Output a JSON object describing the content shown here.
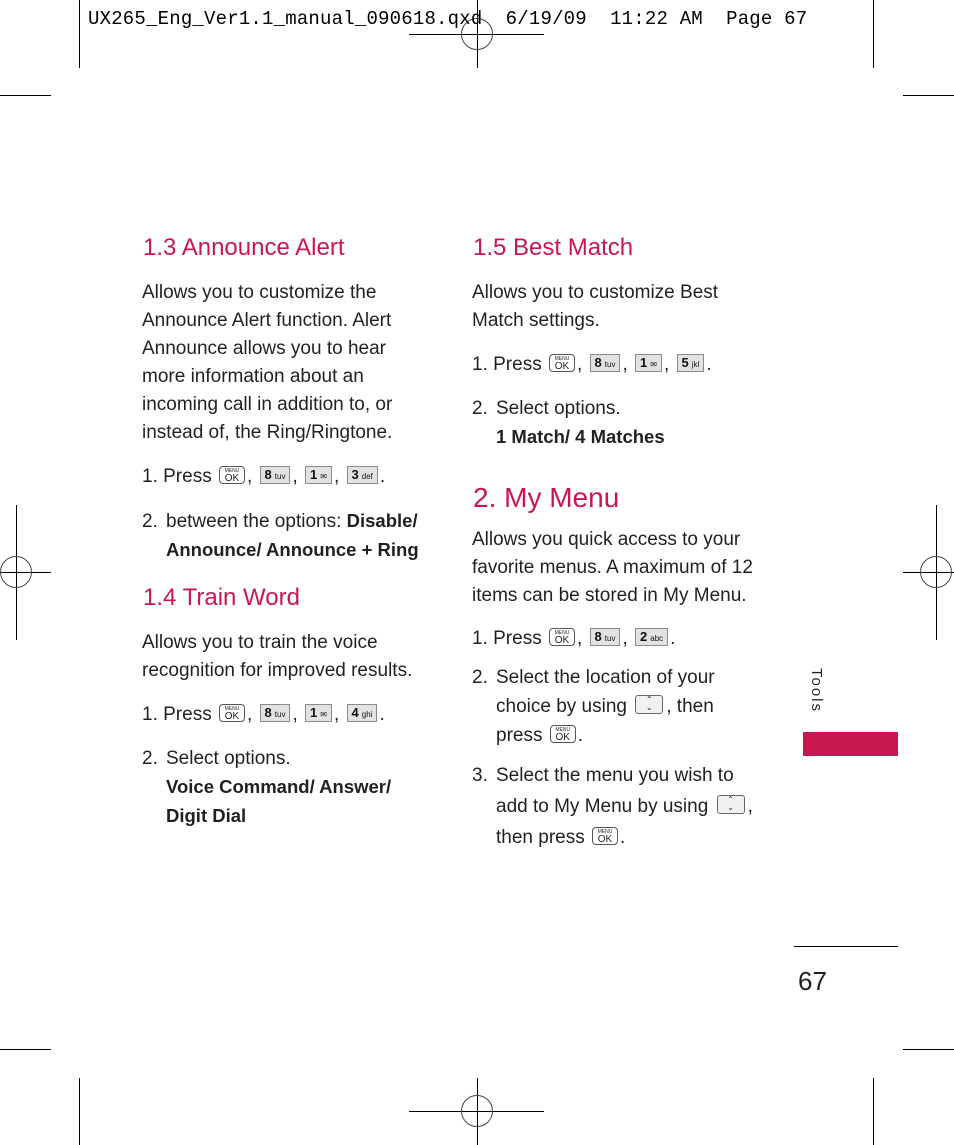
{
  "slug": "UX265_Eng_Ver1.1_manual_090618.qxd  6/19/09  11:22 AM  Page 67",
  "keys": {
    "menu_ok": {
      "top": "MENU",
      "main": "OK"
    },
    "k8": {
      "digit": "8",
      "letters": "tuv"
    },
    "k1": {
      "digit": "1",
      "letters": "✉"
    },
    "k3": {
      "digit": "3",
      "letters": "def"
    },
    "k4": {
      "digit": "4",
      "letters": "ghi"
    },
    "k5": {
      "digit": "5",
      "letters": "jkl"
    },
    "k2": {
      "digit": "2",
      "letters": "abc"
    },
    "nav": {
      "up": "⌃",
      "down": "⌄"
    }
  },
  "sections": {
    "announce_alert": {
      "title": "1.3 Announce Alert",
      "body": "Allows you to customize the Announce Alert function. Alert Announce allows you to hear more information about an incoming call in addition to, or instead of, the Ring/Ringtone.",
      "step1_prefix": "1. Press",
      "step2_num": "2.",
      "step2_text": "between the options: ",
      "step2_options_a": "Disable/",
      "step2_options_b": "Announce/ Announce + Ring"
    },
    "train_word": {
      "title": "1.4 Train Word",
      "body": "Allows you to train the voice recognition for improved results.",
      "step1_prefix": "1. Press",
      "step2_num": "2.",
      "step2_text": "Select options.",
      "step2_options_a": "Voice Command/ Answer/",
      "step2_options_b": "Digit Dial"
    },
    "best_match": {
      "title": "1.5 Best Match",
      "body": "Allows you to customize Best Match settings.",
      "step1_prefix": "1. Press",
      "step2_num": "2.",
      "step2_text": "Select options.",
      "step2_options": "1 Match/ 4 Matches"
    },
    "my_menu": {
      "title": "2. My Menu",
      "body": "Allows you quick access to your favorite menus. A maximum of 12 items can be stored in My Menu.",
      "step1_prefix": "1. Press",
      "step2_num": "2.",
      "step2_line1": "Select the location of your",
      "step2_line2a": "choice by using",
      "step2_line2b": ", then",
      "step2_line3": "press",
      "step3_num": "3.",
      "step3_line1": "Select the menu you wish to",
      "step3_line2": "add to My Menu by using",
      "step3_line3": "then press"
    }
  },
  "sidebar": {
    "label": "Tools",
    "accent_color": "#c8174f"
  },
  "page_number": "67",
  "punct": {
    "comma": ",",
    "period": "."
  }
}
